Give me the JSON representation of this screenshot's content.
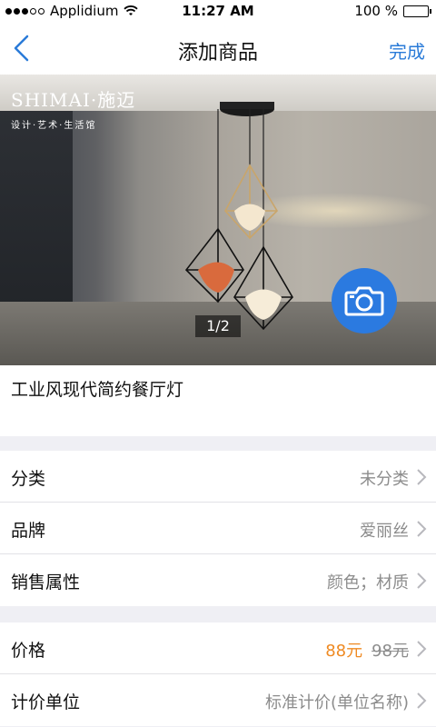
{
  "status_bar": {
    "carrier": "Applidium",
    "time": "11:27 AM",
    "battery": "100 %",
    "battery_level": 1.0
  },
  "nav": {
    "title": "添加商品",
    "done_label": "完成",
    "accent": "#2a7bd8"
  },
  "photo": {
    "brand_logo": "SHIMAI·施迈",
    "brand_sub": "设计·艺术·生活馆",
    "counter": "1/2",
    "camera_color": "#2b7ae0"
  },
  "product": {
    "name": "工业风现代简约餐厅灯"
  },
  "group1": [
    {
      "label": "分类",
      "value": "未分类"
    },
    {
      "label": "品牌",
      "value": "爱丽丝"
    },
    {
      "label": "销售属性",
      "value": "颜色；材质"
    }
  ],
  "group2": {
    "price_label": "价格",
    "price_now": "88元",
    "price_old": "98元",
    "price_color": "#ef8a22",
    "unit_label": "计价单位",
    "unit_value": "标准计价(单位名称)"
  }
}
